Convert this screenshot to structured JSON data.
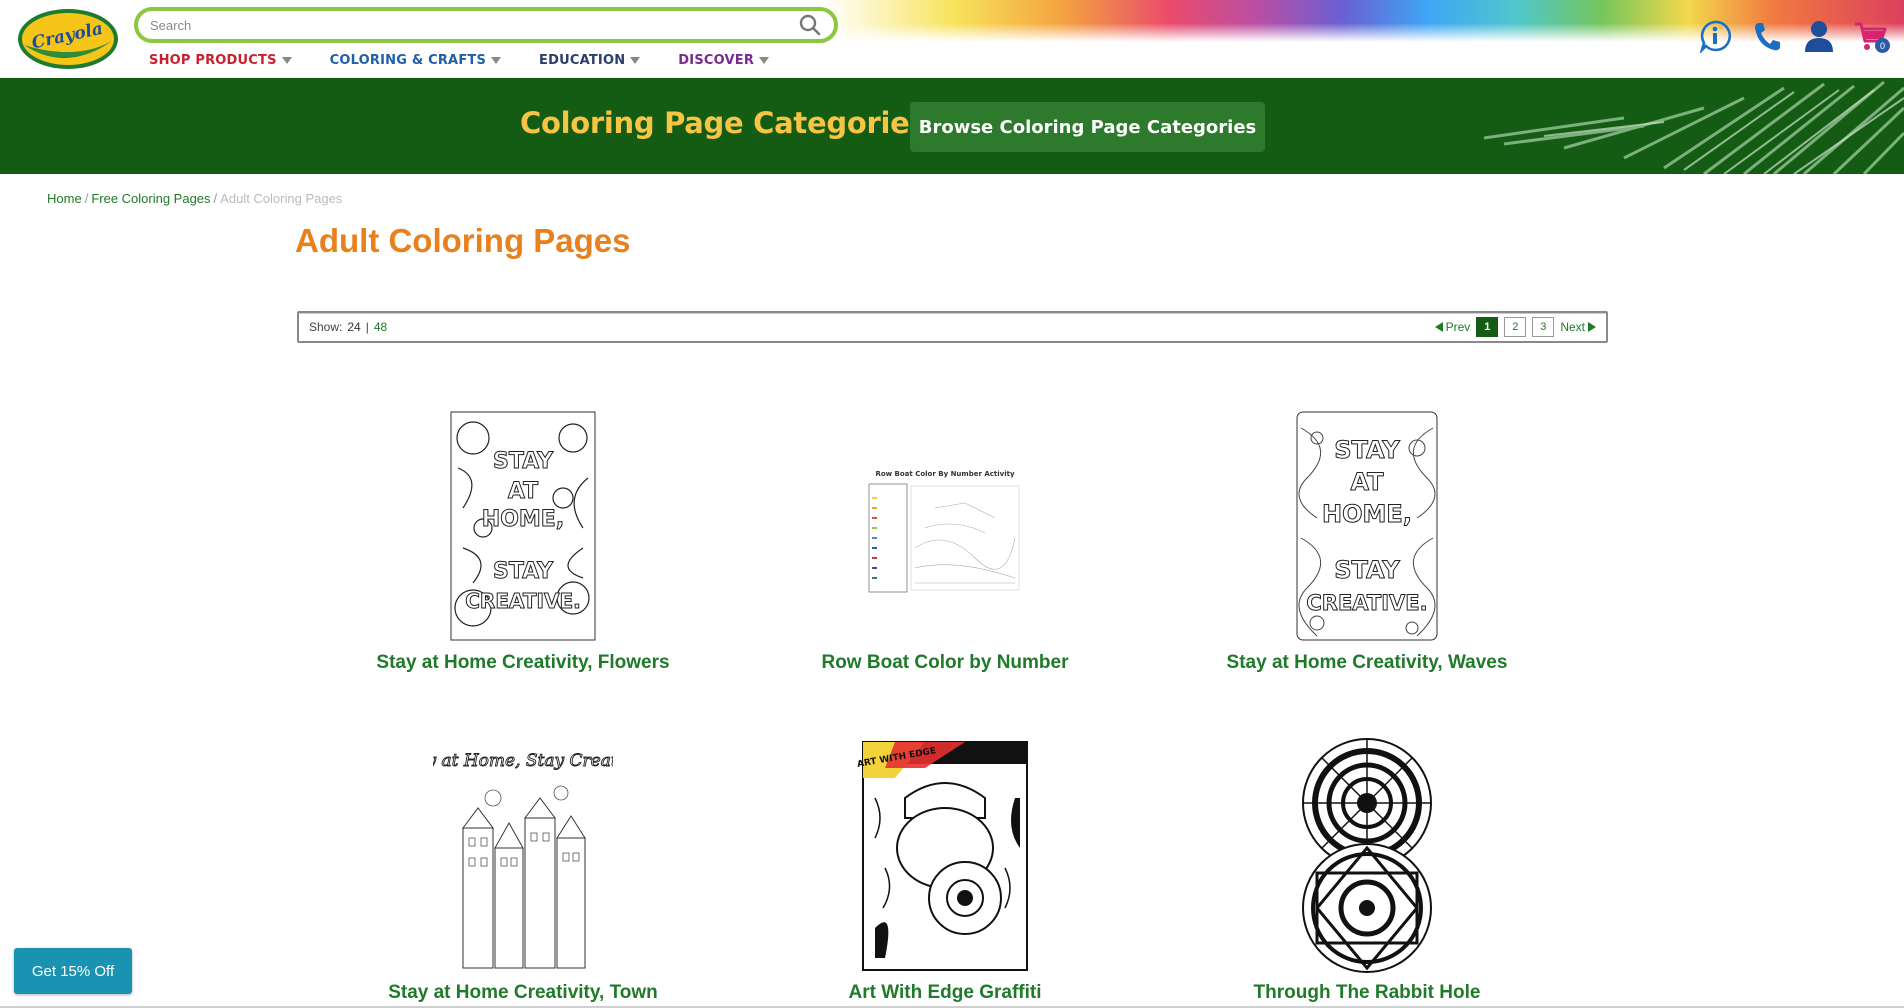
{
  "brand": {
    "logo_text": "Crayola"
  },
  "search": {
    "placeholder": "Search"
  },
  "nav": {
    "items": [
      {
        "label": "SHOP PRODUCTS",
        "color": "#c8202f"
      },
      {
        "label": "COLORING & CRAFTS",
        "color": "#1f5fa8"
      },
      {
        "label": "EDUCATION",
        "color": "#2b3d6b"
      },
      {
        "label": "DISCOVER",
        "color": "#7a2a8c"
      }
    ]
  },
  "utility": {
    "cart_count": "0"
  },
  "banner": {
    "title": "Coloring Page Categories :",
    "button_label": "Browse Coloring Page Categories"
  },
  "breadcrumb": {
    "home": "Home",
    "free": "Free Coloring Pages",
    "current": "Adult Coloring Pages"
  },
  "page": {
    "title": "Adult Coloring Pages"
  },
  "toolbar": {
    "show_label": "Show:",
    "show_24": "24",
    "divider": "|",
    "show_48": "48",
    "prev": "Prev",
    "next": "Next",
    "pages": [
      "1",
      "2",
      "3"
    ],
    "current_page": "1"
  },
  "cards": [
    {
      "title": "Stay at Home Creativity, Flowers"
    },
    {
      "title": "Row Boat Color by Number",
      "thumb_caption": "Row Boat Color By Number Activity"
    },
    {
      "title": "Stay at Home Creativity, Waves"
    },
    {
      "title": "Stay at Home Creativity, Town",
      "thumb_caption": "Stay at Home, Stay Creative."
    },
    {
      "title": "Art With Edge Graffiti",
      "thumb_caption": "ART WITH EDGE"
    },
    {
      "title": "Through The Rabbit Hole"
    }
  ],
  "promo": {
    "label": "Get 15% Off"
  },
  "colors": {
    "green_dark": "#145c14",
    "orange": "#e8801e",
    "yellow": "#f7c443",
    "link_green": "#1f7a2a"
  }
}
